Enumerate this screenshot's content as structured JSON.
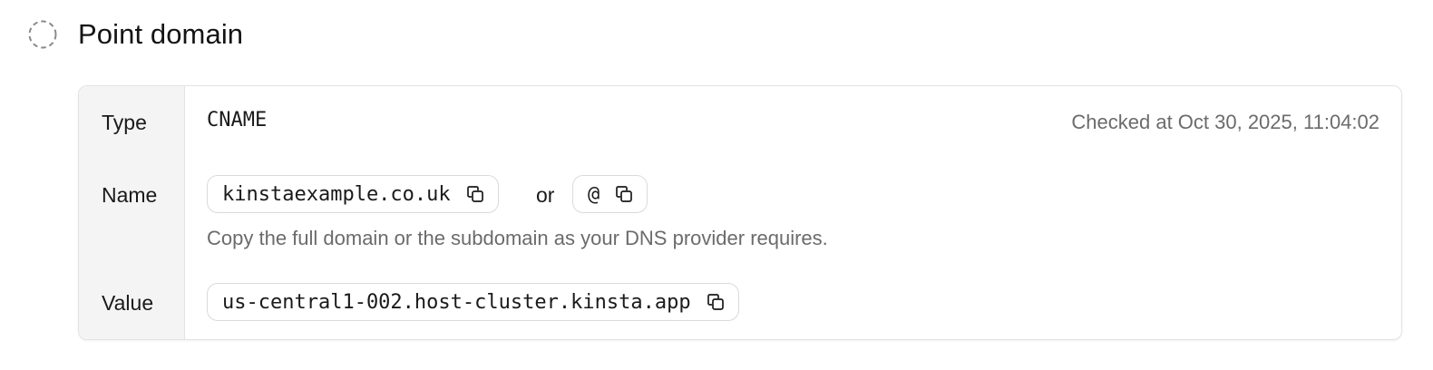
{
  "step": {
    "title": "Point domain",
    "status_icon": "pending-dashed-circle-icon"
  },
  "record": {
    "type_label": "Type",
    "type_value": "CNAME",
    "checked_text": "Checked at Oct 30, 2025, 11:04:02",
    "name_label": "Name",
    "name_full": "kinstaexample.co.uk",
    "name_or": "or",
    "name_short": "@",
    "name_hint": "Copy the full domain or the subdomain as your DNS provider requires.",
    "value_label": "Value",
    "value": "us-central1-002.host-cluster.kinsta.app",
    "copy_icon": "copy-icon"
  }
}
